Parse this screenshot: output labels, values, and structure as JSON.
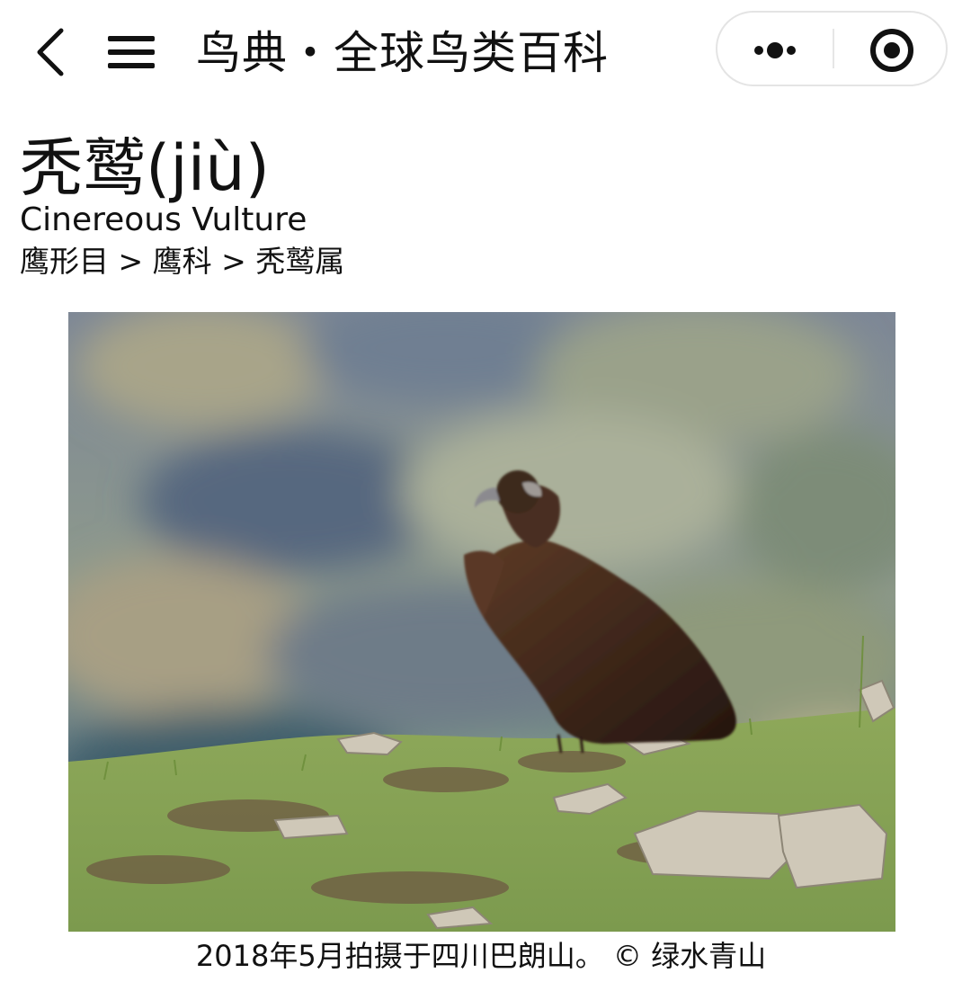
{
  "nav": {
    "title": "鸟典・全球鸟类百科",
    "back_icon": "chevron-left-icon",
    "menu_icon": "hamburger-menu-icon",
    "more_icon": "more-dots-icon",
    "close_icon": "target-circle-icon"
  },
  "species": {
    "chinese_name": "秃鹫(jiù)",
    "english_name": "Cinereous Vulture",
    "taxonomy": "鹰形目 > 鹰科 > 秃鹫属"
  },
  "photo": {
    "caption": "2018年5月拍摄于四川巴朗山。 © 绿水青山"
  }
}
